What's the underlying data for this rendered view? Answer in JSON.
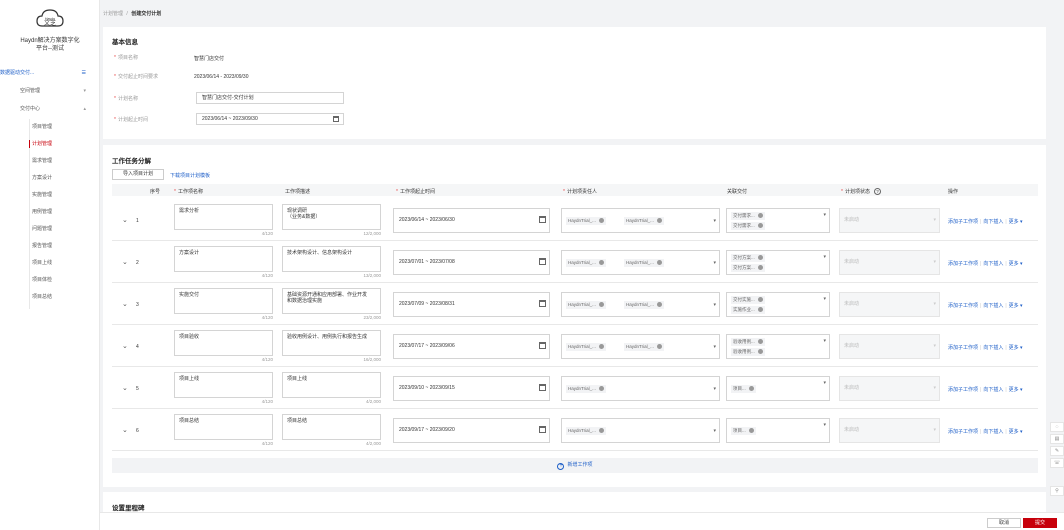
{
  "sidebar": {
    "logo_text": "Haydn",
    "brand_line1": "Haydn解决方案数字化",
    "brand_line2": "平台--测试",
    "module_title": "数据驱动交付...",
    "items": [
      {
        "label": "空间管理",
        "chevron": "▾"
      },
      {
        "label": "交付中心",
        "chevron": "▴"
      }
    ],
    "subitems": [
      "项目管理",
      "计划管理",
      "需求管理",
      "方案设计",
      "实施管理",
      "用例管理",
      "问题管理",
      "报告管理",
      "项目上线",
      "项目体检",
      "项目总结"
    ]
  },
  "breadcrumb": {
    "parent": "计划管理",
    "sep": "/",
    "current": "创建交付计划"
  },
  "basic": {
    "title": "基本信息",
    "fields": [
      {
        "label": "项目名称",
        "value": "智慧门店交付"
      },
      {
        "label": "交付起止时间要求",
        "value": "2023/06/14 - 2023/09/30"
      },
      {
        "label": "计划名称",
        "value": "智慧门店交付-交付计划"
      },
      {
        "label": "计划起止时间",
        "value": "2023/06/14 ~ 2023/09/30"
      }
    ]
  },
  "tasks": {
    "title": "工作任务分解",
    "import_btn": "导入项目计划",
    "download_link": "下载项目计划模板",
    "headers": {
      "seq": "序号",
      "name": "工作项名称",
      "desc": "工作项描述",
      "time": "工作项起止时间",
      "owner": "计划项责任人",
      "related": "关联交付",
      "status": "计划项状态",
      "op": "操作"
    },
    "rows": [
      {
        "seq": "1",
        "name": "需求分析",
        "name_count": "4/120",
        "desc_line1": "现状调研",
        "desc_line2": "（业务&数据）",
        "desc_count": "12/2,000",
        "time": "2023/06/14 ~ 2023/06/30",
        "owners": [
          "HaydnTrial_...",
          "HaydnTrial_..."
        ],
        "related": [
          "交付需求...",
          "交付需求..."
        ],
        "status": "未启动"
      },
      {
        "seq": "2",
        "name": "方案设计",
        "name_count": "4/120",
        "desc_line1": "技术架构设计、信息架构设计",
        "desc_line2": "",
        "desc_count": "13/2,000",
        "time": "2023/07/01 ~ 2023/07/08",
        "owners": [
          "HaydnTrial_...",
          "HaydnTrial_..."
        ],
        "related": [
          "交付方案...",
          "交付方案..."
        ],
        "status": "未启动"
      },
      {
        "seq": "3",
        "name": "实施交付",
        "name_count": "4/120",
        "desc_line1": "基础资源开通和应用部署、作业开发",
        "desc_line2": "和数据治理实施",
        "desc_count": "23/2,000",
        "time": "2023/07/09 ~ 2023/08/31",
        "owners": [
          "HaydnTrial_...",
          "HaydnTrial_..."
        ],
        "related": [
          "交付实施...",
          "实施作业..."
        ],
        "status": "未启动"
      },
      {
        "seq": "4",
        "name": "项目验收",
        "name_count": "4/120",
        "desc_line1": "验收用例设计、用例执行和报告生成",
        "desc_line2": "",
        "desc_count": "16/2,000",
        "time": "2023/07/17 ~ 2023/09/06",
        "owners": [
          "HaydnTrial_...",
          "HaydnTrial_..."
        ],
        "related": [
          "验收用例...",
          "验收用例..."
        ],
        "status": "未启动"
      },
      {
        "seq": "5",
        "name": "项目上线",
        "name_count": "4/120",
        "desc_line1": "项目上线",
        "desc_line2": "",
        "desc_count": "4/2,000",
        "time": "2023/09/10 ~ 2023/09/15",
        "owners": [
          "HaydnTrial_..."
        ],
        "related": [
          "项目..."
        ],
        "status": "未启动"
      },
      {
        "seq": "6",
        "name": "项目总结",
        "name_count": "4/120",
        "desc_line1": "项目总结",
        "desc_line2": "",
        "desc_count": "4/2,000",
        "time": "2023/09/17 ~ 2023/09/20",
        "owners": [
          "HaydnTrial_..."
        ],
        "related": [
          "项目..."
        ],
        "status": "未启动"
      }
    ],
    "ops": {
      "add_child": "添加子工作项",
      "insert_below": "向下插入",
      "more": "更多 ▾"
    },
    "add_task": "新增工作项"
  },
  "milestone": {
    "title": "设置里程碑"
  },
  "footer": {
    "cancel": "取消",
    "submit": "提交"
  },
  "colors": {
    "accent": "#c7000b",
    "link": "#1e5fc8"
  }
}
